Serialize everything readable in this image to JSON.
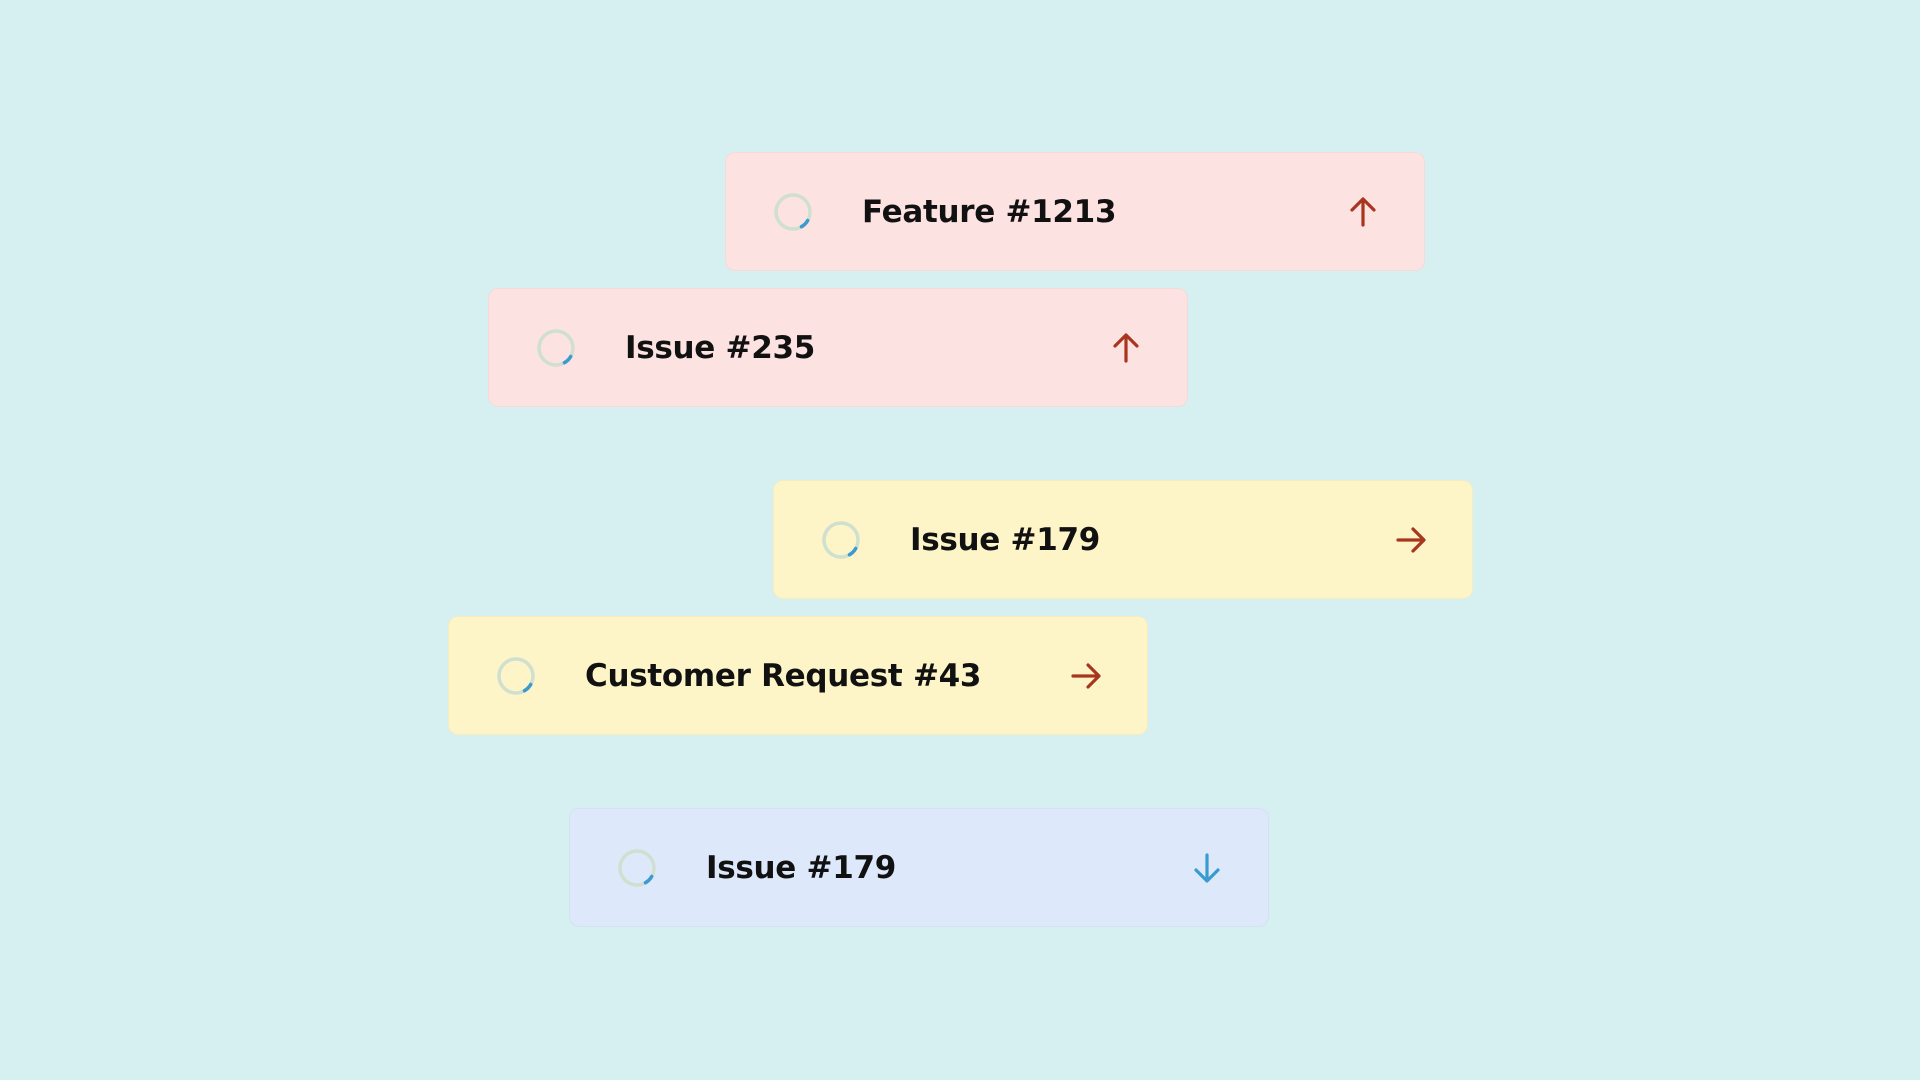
{
  "cards": [
    {
      "title": "Feature #1213",
      "priority": "high",
      "priority_icon": "arrow-up-icon"
    },
    {
      "title": "Issue #235",
      "priority": "high",
      "priority_icon": "arrow-up-icon"
    },
    {
      "title": "Issue #179",
      "priority": "medium",
      "priority_icon": "arrow-right-icon"
    },
    {
      "title": "Customer Request #43",
      "priority": "medium",
      "priority_icon": "arrow-right-icon"
    },
    {
      "title": "Issue #179",
      "priority": "low",
      "priority_icon": "arrow-down-icon"
    }
  ],
  "colors": {
    "background": "#d6f0f1",
    "high_card": "#fde2e2",
    "medium_card": "#fdf4c8",
    "low_card": "#dde9fb",
    "arrow_red": "#a8361c",
    "arrow_blue": "#3a9bd1",
    "status_ring": "#cfe0cf",
    "status_progress": "#3a9bd1"
  },
  "status_icon": "in-progress-icon"
}
